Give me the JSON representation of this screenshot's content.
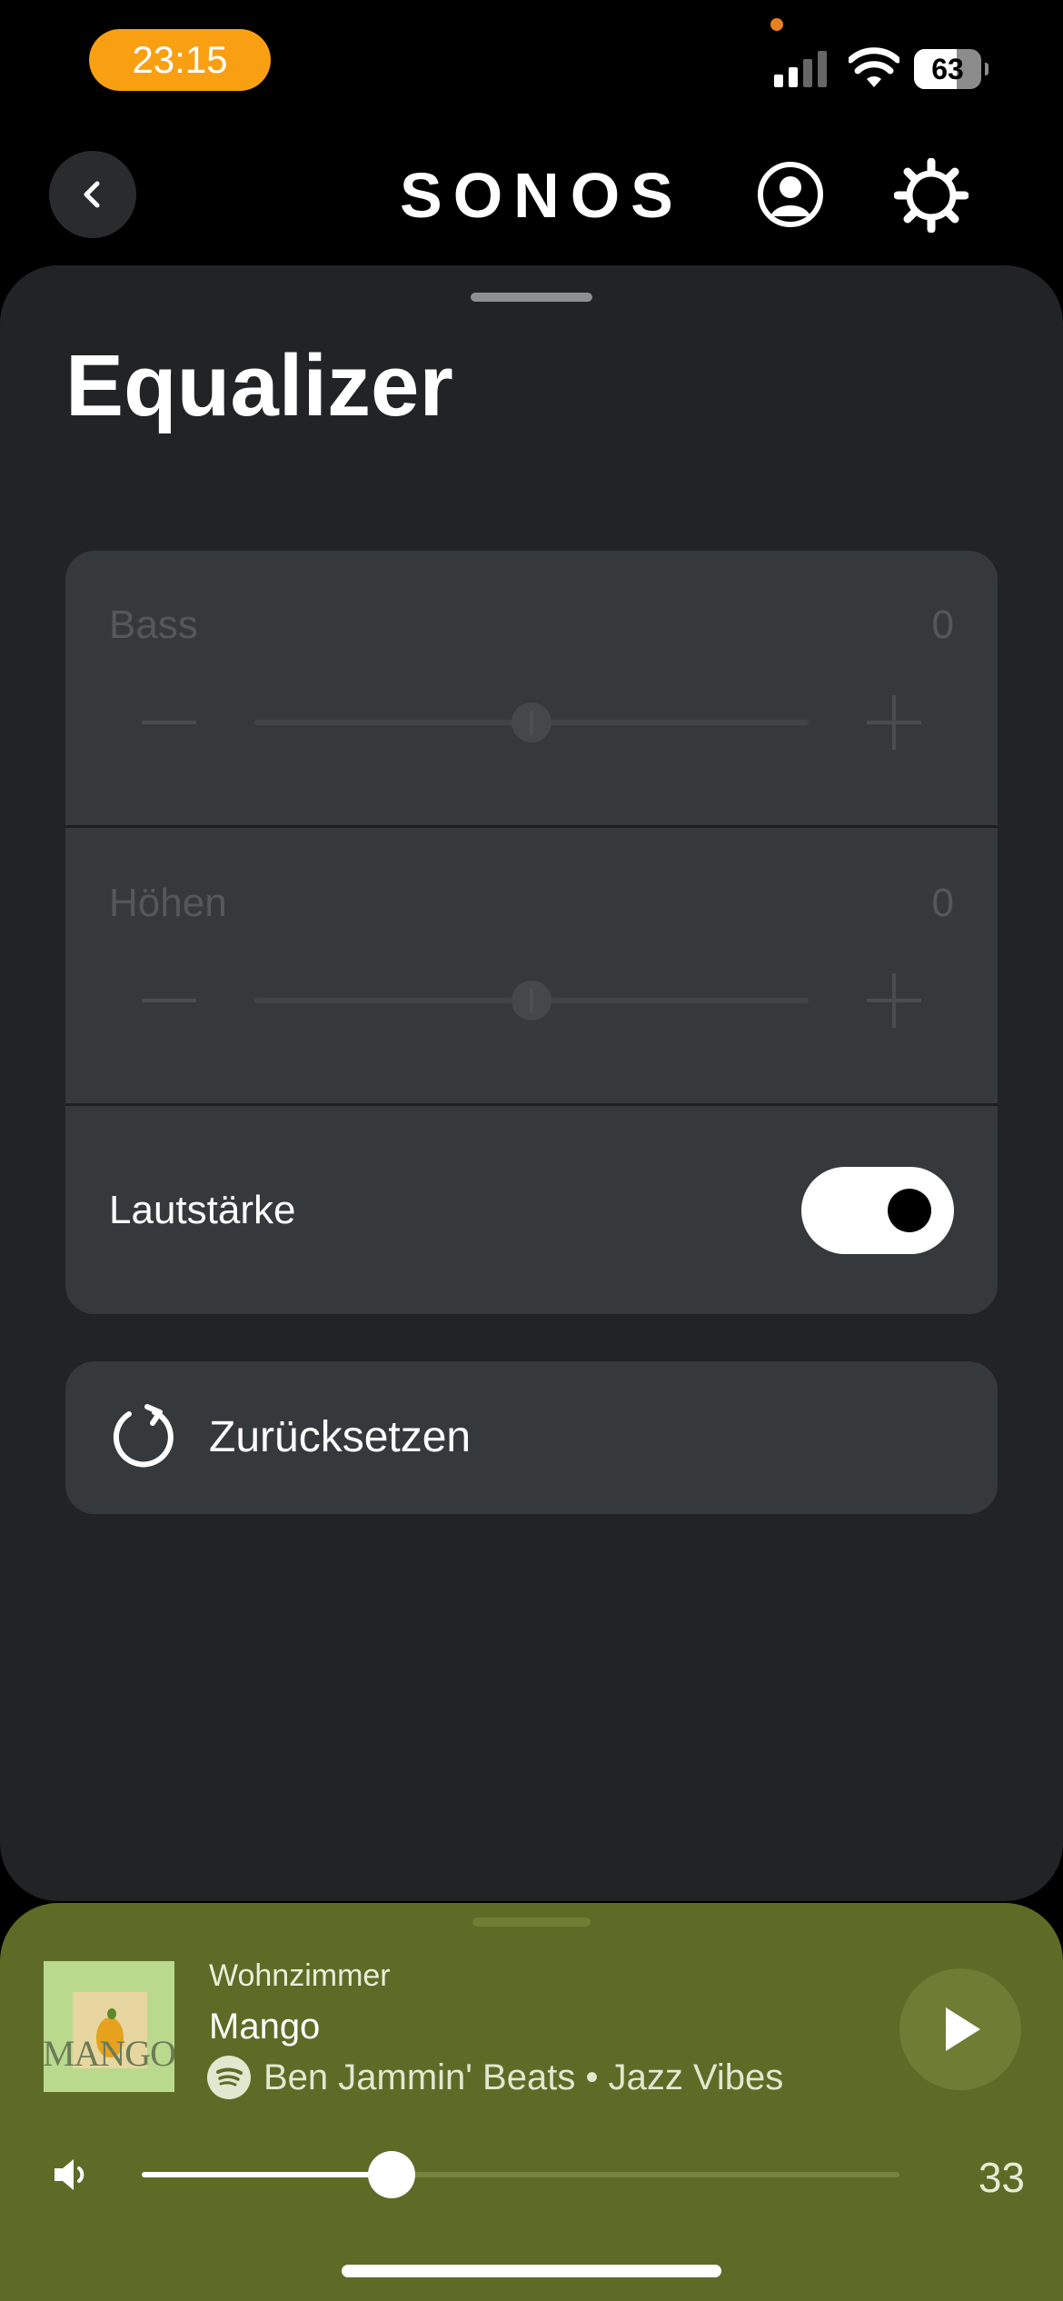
{
  "status_bar": {
    "time": "23:15",
    "battery_percent": "63",
    "battery_level": 0.63
  },
  "nav": {
    "logo": "SONOS",
    "icons": [
      "back-chevron-icon",
      "account-icon",
      "gear-icon"
    ]
  },
  "page": {
    "title": "Equalizer"
  },
  "equalizer": {
    "bass": {
      "label": "Bass",
      "value": "0",
      "level": 0.5,
      "enabled": false
    },
    "treble": {
      "label": "Höhen",
      "value": "0",
      "level": 0.5,
      "enabled": false
    },
    "loudness": {
      "label": "Lautstärke",
      "on": true
    }
  },
  "reset": {
    "label": "Zurücksetzen",
    "icon": "reset-icon"
  },
  "now_playing": {
    "room": "Wohnzimmer",
    "title": "Mango",
    "artist_line": "Ben Jammin' Beats • Jazz Vibes",
    "source_icon": "spotify-icon",
    "album_art_text": "MANGO",
    "volume": "33",
    "volume_level": 0.33
  },
  "colors": {
    "time_pill": "#f9a012",
    "sheet": "#222325",
    "card": "#36393b",
    "player": "#5d6b27"
  }
}
